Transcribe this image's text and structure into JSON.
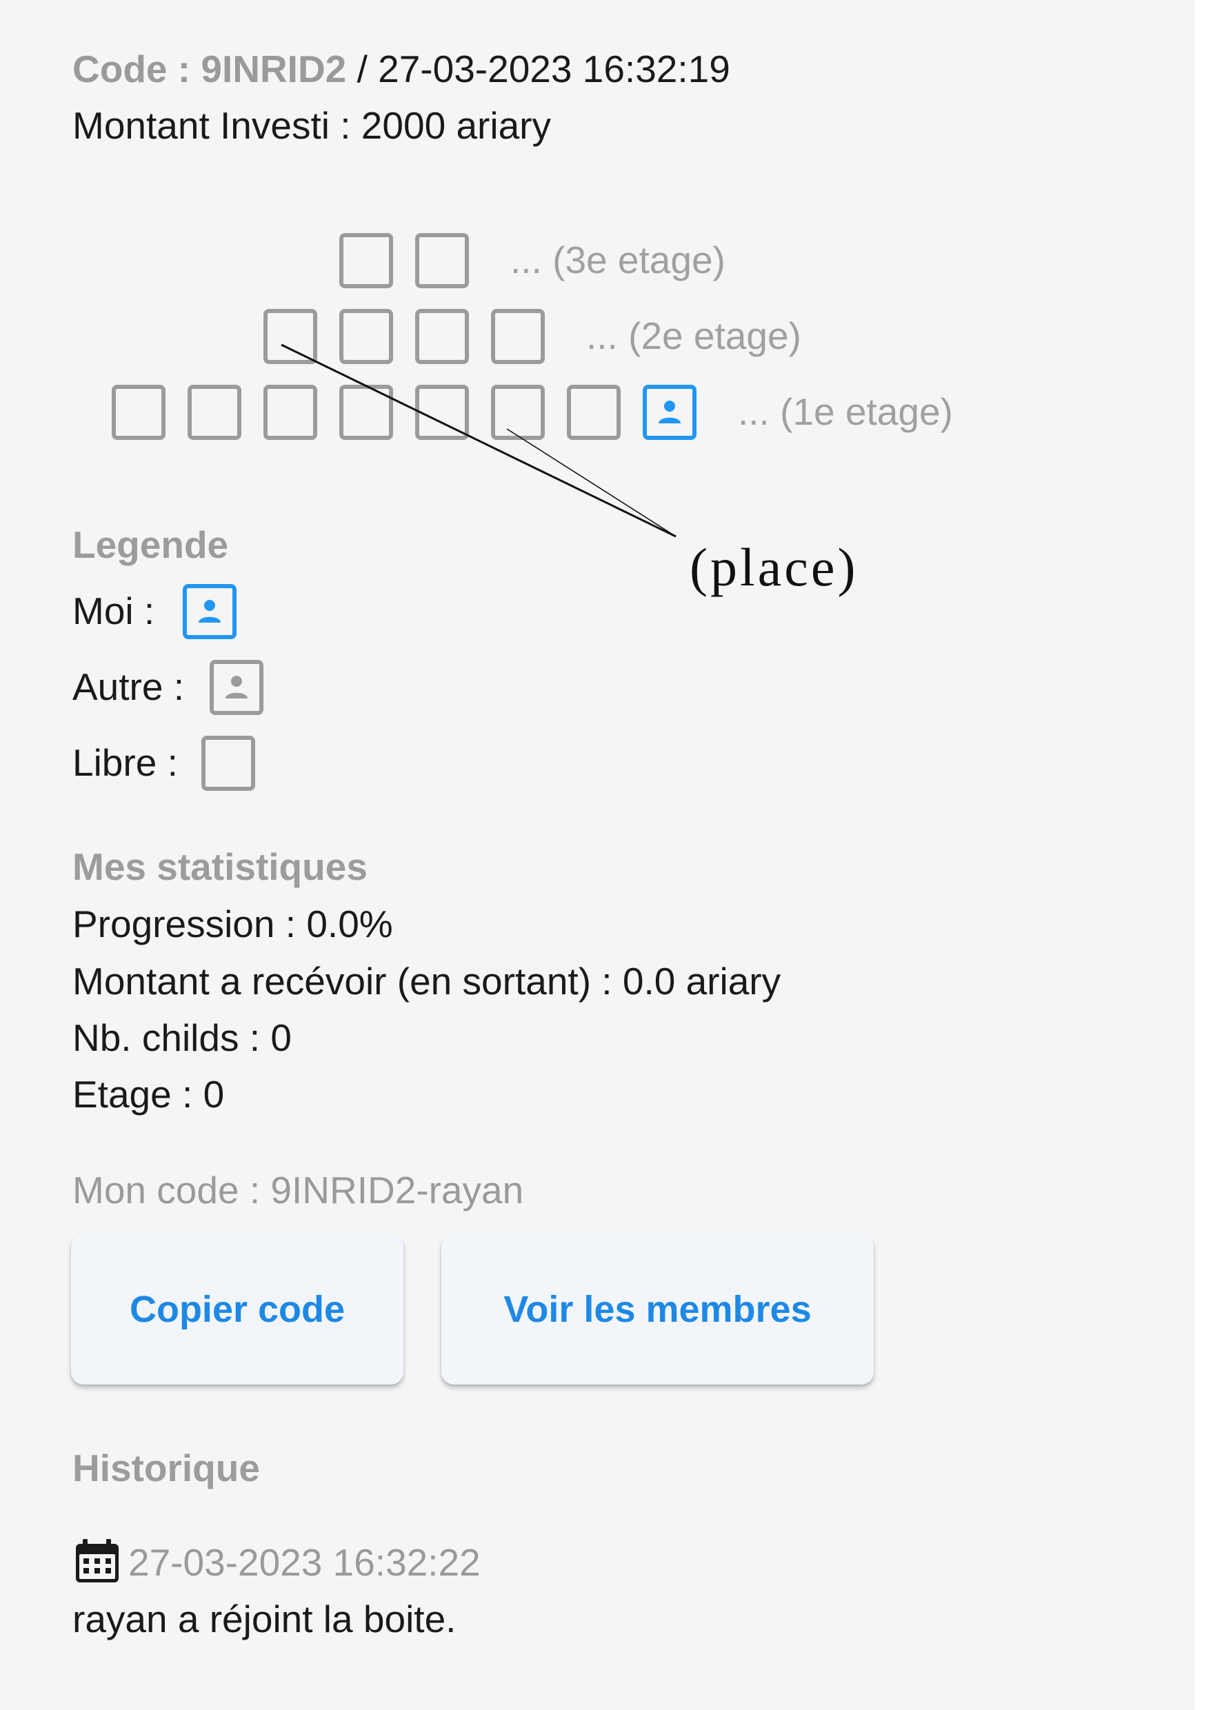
{
  "header": {
    "code_label": "Code : 9INRID2",
    "datetime": "/ 27-03-2023 16:32:19",
    "amount": "Montant Investi : 2000 ariary"
  },
  "tree": {
    "floors": [
      {
        "label": "... (3e etage)",
        "slots": 2
      },
      {
        "label": "... (2e etage)",
        "slots": 4
      },
      {
        "label": "... (1e etage)",
        "slots": 8,
        "me_index": 7
      }
    ],
    "annotation": "(place)"
  },
  "legend": {
    "title": "Legende",
    "items": [
      {
        "label": "Moi :",
        "state": "me"
      },
      {
        "label": "Autre :",
        "state": "other"
      },
      {
        "label": "Libre :",
        "state": "free"
      }
    ]
  },
  "stats": {
    "title": "Mes statistiques",
    "progression": "Progression : 0.0%",
    "montant": "Montant a recévoir (en sortant) : 0.0 ariary",
    "childs": "Nb. childs : 0",
    "etage": "Etage : 0"
  },
  "code_section": {
    "my_code": "Mon code : 9INRID2-rayan",
    "copy_button": "Copier code",
    "members_button": "Voir les membres"
  },
  "history": {
    "title": "Historique",
    "entries": [
      {
        "date": "27-03-2023 16:32:22",
        "message": "rayan a réjoint la boite."
      }
    ]
  },
  "colors": {
    "accent": "#2196f3",
    "button_text": "#1e88e5",
    "muted": "#9b9b9b",
    "background": "#f5f5f5"
  },
  "icons": {
    "me": "person-icon",
    "other": "person-icon",
    "history": "calendar-icon"
  }
}
